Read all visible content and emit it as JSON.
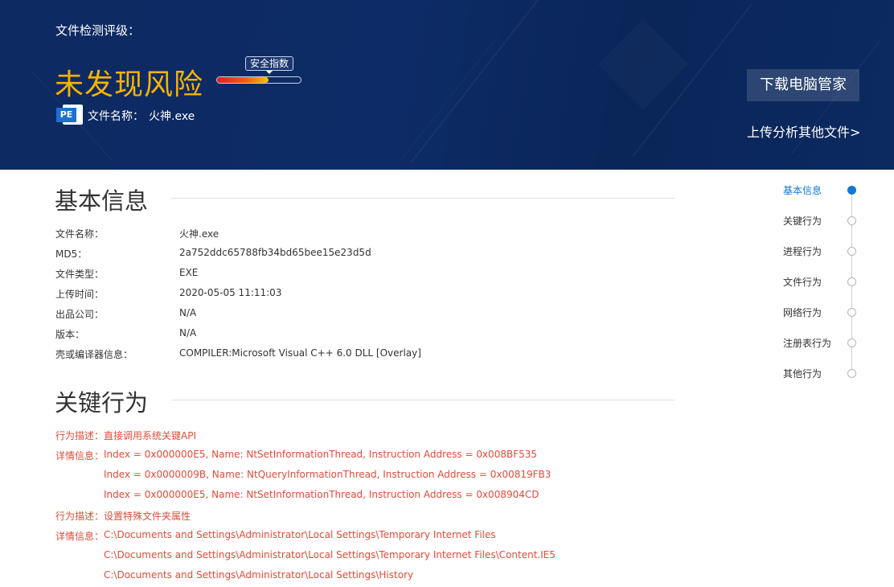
{
  "banner": {
    "rating_label": "文件检测评级：",
    "result": "未发现风险",
    "safety_index_label": "安全指数",
    "safety_index_level": 0.62,
    "file_type_icon": "pe-file-icon",
    "file_type_icon_text": "PE",
    "file_name_label": "文件名称：",
    "file_name": "火神.exe",
    "download_button": "下载电脑管家",
    "upload_link": "上传分析其他文件>"
  },
  "basic_info": {
    "title": "基本信息",
    "rows": [
      {
        "label": "文件名称：",
        "value": "火神.exe"
      },
      {
        "label": "MD5：",
        "value": "2a752ddc65788fb34bd65bee15e23d5d"
      },
      {
        "label": "文件类型：",
        "value": "EXE"
      },
      {
        "label": "上传时间：",
        "value": "2020-05-05 11:11:03"
      },
      {
        "label": "出品公司：",
        "value": "N/A"
      },
      {
        "label": "版本：",
        "value": "N/A"
      },
      {
        "label": "壳或编译器信息：",
        "value": "COMPILER:Microsoft Visual C++ 6.0 DLL [Overlay]"
      }
    ]
  },
  "key_behavior": {
    "title": "关键行为",
    "rows": [
      {
        "label": "行为描述：",
        "value": "直接调用系统关键API"
      },
      {
        "label": "详情信息：",
        "value": "Index = 0x000000E5, Name: NtSetInformationThread, Instruction Address = 0x008BF535"
      },
      {
        "label": "",
        "value": "Index = 0x0000009B, Name: NtQueryInformationThread, Instruction Address = 0x00819FB3"
      },
      {
        "label": "",
        "value": "Index = 0x000000E5, Name: NtSetInformationThread, Instruction Address = 0x008904CD"
      },
      {
        "label": "行为描述：",
        "value": "设置特殊文件夹属性"
      },
      {
        "label": "详情信息：",
        "value": "C:\\Documents and Settings\\Administrator\\Local Settings\\Temporary Internet Files"
      },
      {
        "label": "",
        "value": "C:\\Documents and Settings\\Administrator\\Local Settings\\Temporary Internet Files\\Content.IE5"
      },
      {
        "label": "",
        "value": "C:\\Documents and Settings\\Administrator\\Local Settings\\History"
      }
    ]
  },
  "nav": {
    "active_index": 0,
    "items": [
      "基本信息",
      "关键行为",
      "进程行为",
      "文件行为",
      "网络行为",
      "注册表行为",
      "其他行为"
    ]
  },
  "colors": {
    "banner_bg": "#0d2b66",
    "result_text": "#f5b400",
    "behavior_text": "#e14b3a",
    "nav_active": "#1479d4"
  }
}
